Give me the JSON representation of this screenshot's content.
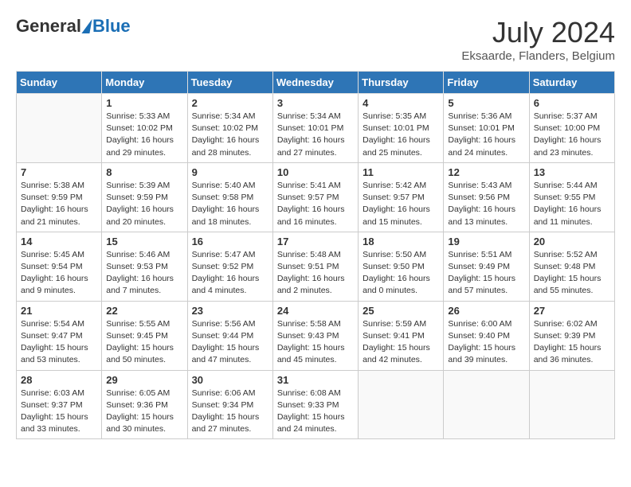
{
  "logo": {
    "general": "General",
    "blue": "Blue"
  },
  "title": "July 2024",
  "location": "Eksaarde, Flanders, Belgium",
  "weekdays": [
    "Sunday",
    "Monday",
    "Tuesday",
    "Wednesday",
    "Thursday",
    "Friday",
    "Saturday"
  ],
  "weeks": [
    [
      {
        "day": "",
        "info": ""
      },
      {
        "day": "1",
        "info": "Sunrise: 5:33 AM\nSunset: 10:02 PM\nDaylight: 16 hours\nand 29 minutes."
      },
      {
        "day": "2",
        "info": "Sunrise: 5:34 AM\nSunset: 10:02 PM\nDaylight: 16 hours\nand 28 minutes."
      },
      {
        "day": "3",
        "info": "Sunrise: 5:34 AM\nSunset: 10:01 PM\nDaylight: 16 hours\nand 27 minutes."
      },
      {
        "day": "4",
        "info": "Sunrise: 5:35 AM\nSunset: 10:01 PM\nDaylight: 16 hours\nand 25 minutes."
      },
      {
        "day": "5",
        "info": "Sunrise: 5:36 AM\nSunset: 10:01 PM\nDaylight: 16 hours\nand 24 minutes."
      },
      {
        "day": "6",
        "info": "Sunrise: 5:37 AM\nSunset: 10:00 PM\nDaylight: 16 hours\nand 23 minutes."
      }
    ],
    [
      {
        "day": "7",
        "info": "Sunrise: 5:38 AM\nSunset: 9:59 PM\nDaylight: 16 hours\nand 21 minutes."
      },
      {
        "day": "8",
        "info": "Sunrise: 5:39 AM\nSunset: 9:59 PM\nDaylight: 16 hours\nand 20 minutes."
      },
      {
        "day": "9",
        "info": "Sunrise: 5:40 AM\nSunset: 9:58 PM\nDaylight: 16 hours\nand 18 minutes."
      },
      {
        "day": "10",
        "info": "Sunrise: 5:41 AM\nSunset: 9:57 PM\nDaylight: 16 hours\nand 16 minutes."
      },
      {
        "day": "11",
        "info": "Sunrise: 5:42 AM\nSunset: 9:57 PM\nDaylight: 16 hours\nand 15 minutes."
      },
      {
        "day": "12",
        "info": "Sunrise: 5:43 AM\nSunset: 9:56 PM\nDaylight: 16 hours\nand 13 minutes."
      },
      {
        "day": "13",
        "info": "Sunrise: 5:44 AM\nSunset: 9:55 PM\nDaylight: 16 hours\nand 11 minutes."
      }
    ],
    [
      {
        "day": "14",
        "info": "Sunrise: 5:45 AM\nSunset: 9:54 PM\nDaylight: 16 hours\nand 9 minutes."
      },
      {
        "day": "15",
        "info": "Sunrise: 5:46 AM\nSunset: 9:53 PM\nDaylight: 16 hours\nand 7 minutes."
      },
      {
        "day": "16",
        "info": "Sunrise: 5:47 AM\nSunset: 9:52 PM\nDaylight: 16 hours\nand 4 minutes."
      },
      {
        "day": "17",
        "info": "Sunrise: 5:48 AM\nSunset: 9:51 PM\nDaylight: 16 hours\nand 2 minutes."
      },
      {
        "day": "18",
        "info": "Sunrise: 5:50 AM\nSunset: 9:50 PM\nDaylight: 16 hours\nand 0 minutes."
      },
      {
        "day": "19",
        "info": "Sunrise: 5:51 AM\nSunset: 9:49 PM\nDaylight: 15 hours\nand 57 minutes."
      },
      {
        "day": "20",
        "info": "Sunrise: 5:52 AM\nSunset: 9:48 PM\nDaylight: 15 hours\nand 55 minutes."
      }
    ],
    [
      {
        "day": "21",
        "info": "Sunrise: 5:54 AM\nSunset: 9:47 PM\nDaylight: 15 hours\nand 53 minutes."
      },
      {
        "day": "22",
        "info": "Sunrise: 5:55 AM\nSunset: 9:45 PM\nDaylight: 15 hours\nand 50 minutes."
      },
      {
        "day": "23",
        "info": "Sunrise: 5:56 AM\nSunset: 9:44 PM\nDaylight: 15 hours\nand 47 minutes."
      },
      {
        "day": "24",
        "info": "Sunrise: 5:58 AM\nSunset: 9:43 PM\nDaylight: 15 hours\nand 45 minutes."
      },
      {
        "day": "25",
        "info": "Sunrise: 5:59 AM\nSunset: 9:41 PM\nDaylight: 15 hours\nand 42 minutes."
      },
      {
        "day": "26",
        "info": "Sunrise: 6:00 AM\nSunset: 9:40 PM\nDaylight: 15 hours\nand 39 minutes."
      },
      {
        "day": "27",
        "info": "Sunrise: 6:02 AM\nSunset: 9:39 PM\nDaylight: 15 hours\nand 36 minutes."
      }
    ],
    [
      {
        "day": "28",
        "info": "Sunrise: 6:03 AM\nSunset: 9:37 PM\nDaylight: 15 hours\nand 33 minutes."
      },
      {
        "day": "29",
        "info": "Sunrise: 6:05 AM\nSunset: 9:36 PM\nDaylight: 15 hours\nand 30 minutes."
      },
      {
        "day": "30",
        "info": "Sunrise: 6:06 AM\nSunset: 9:34 PM\nDaylight: 15 hours\nand 27 minutes."
      },
      {
        "day": "31",
        "info": "Sunrise: 6:08 AM\nSunset: 9:33 PM\nDaylight: 15 hours\nand 24 minutes."
      },
      {
        "day": "",
        "info": ""
      },
      {
        "day": "",
        "info": ""
      },
      {
        "day": "",
        "info": ""
      }
    ]
  ]
}
